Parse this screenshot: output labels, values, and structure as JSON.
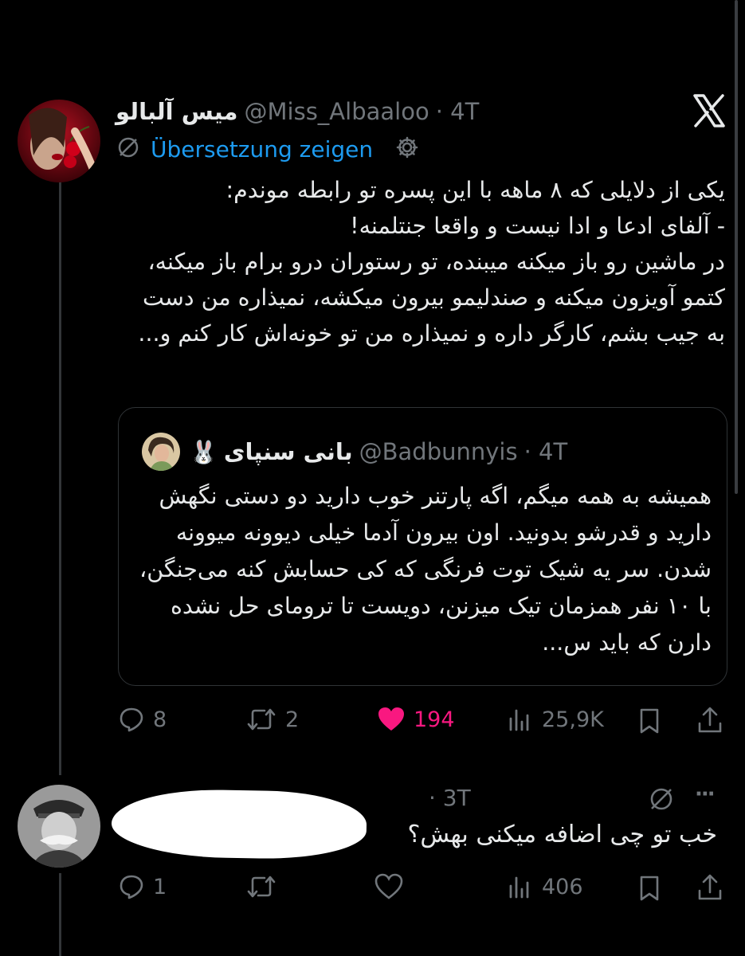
{
  "tweet": {
    "author_name": "میس آلبالو",
    "handle": "@Miss_Albaaloo",
    "time": "· 4T",
    "translate_label": "Übersetzung zeigen",
    "body": "یکی از دلایلی که ۸ ماهه با این پسره تو رابطه موندم:\n- آلفای ادعا و ادا نیست و واقعا جنتلمنه!\nدر ماشین رو باز میکنه میبنده، تو رستوران درو برام باز میکنه، کتمو آویزون میکنه و صندلیمو بیرون میکشه، نمیذاره من دست به جیب بشم، کارگر داره و نمیذاره من تو خونه‌اش کار کنم و...",
    "quote": {
      "author_name": "بانی سنپای",
      "emoji": "🐰",
      "handle": "@Badbunnyis",
      "time": "· 4T",
      "body": "همیشه به همه میگم، اگه پارتنر خوب دارید دو دستی نگهش دارید و قدرشو بدونید. اون بیرون آدما خیلی دیوونه میوونه شدن. سر یه شیک توت فرنگی که کی حسابش کنه می‌جنگن، با ۱۰ نفر همزمان تیک میزنن، دویست تا ترومای حل نشده دارن که باید س..."
    },
    "actions": {
      "replies": "8",
      "retweets": "2",
      "likes": "194",
      "views": "25,9K"
    }
  },
  "reply": {
    "time": "· 3T",
    "more": "···",
    "body": "خب تو چی اضافه میکنی بهش؟",
    "actions": {
      "replies": "1",
      "retweets": "",
      "likes": "",
      "views": "406"
    }
  },
  "colors": {
    "background": "#000000",
    "text": "#e7e9ea",
    "muted": "#71767b",
    "link": "#1d9bf0",
    "like": "#f91880"
  },
  "icons": [
    "x-logo-icon",
    "translate-icon",
    "gear-icon",
    "reply-icon",
    "retweet-icon",
    "heart-icon",
    "views-icon",
    "bookmark-icon",
    "share-icon",
    "no-translate-icon",
    "more-icon"
  ]
}
